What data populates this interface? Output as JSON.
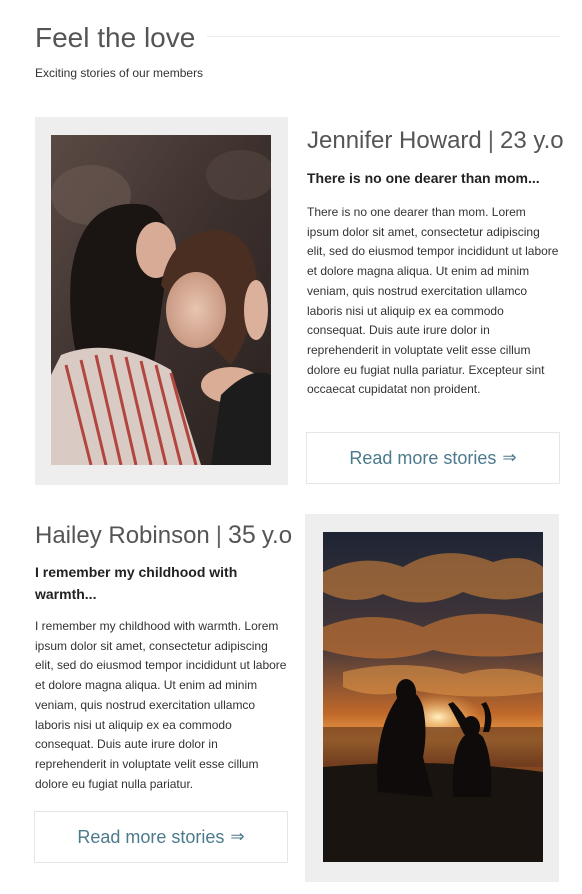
{
  "header": {
    "title": "Feel the love",
    "subtitle": "Exciting stories of our members"
  },
  "stories": [
    {
      "name": "Jennifer Howard",
      "separator": "|",
      "age": "23 y.o",
      "headline": "There is no one dearer than mom...",
      "body": "There is no one dearer than mom. Lorem ipsum dolor sit amet, consectetur adipiscing elit, sed do eiusmod tempor incididunt ut labore et dolore magna aliqua. Ut enim ad minim veniam, quis nostrud exercitation ullamco laboris nisi ut aliquip ex ea commodo consequat. Duis aute irure dolor in reprehenderit in voluptate velit esse cillum dolore eu fugiat nulla pariatur. Excepteur sint occaecat cupidatat non proident.",
      "button_label": "Read more stories",
      "button_arrow": "⇒"
    },
    {
      "name": "Hailey Robinson",
      "separator": "|",
      "age_number": "35",
      "age_unit": "y.o",
      "headline": "I remember my childhood with warmth...",
      "body": "I remember my childhood with warmth. Lorem ipsum dolor sit amet, consectetur adipiscing elit, sed do eiusmod tempor incididunt ut labore et dolore magna aliqua. Ut enim ad minim veniam, quis nostrud exercitation ullamco laboris nisi ut aliquip ex ea commodo consequat. Duis aute irure dolor in reprehenderit in voluptate velit esse cillum dolore eu fugiat nulla pariatur.",
      "button_label": "Read more stories",
      "button_arrow": "⇒"
    }
  ],
  "colors": {
    "link": "#4b7a8c",
    "frame": "#eeeeee",
    "heading": "#555555"
  }
}
